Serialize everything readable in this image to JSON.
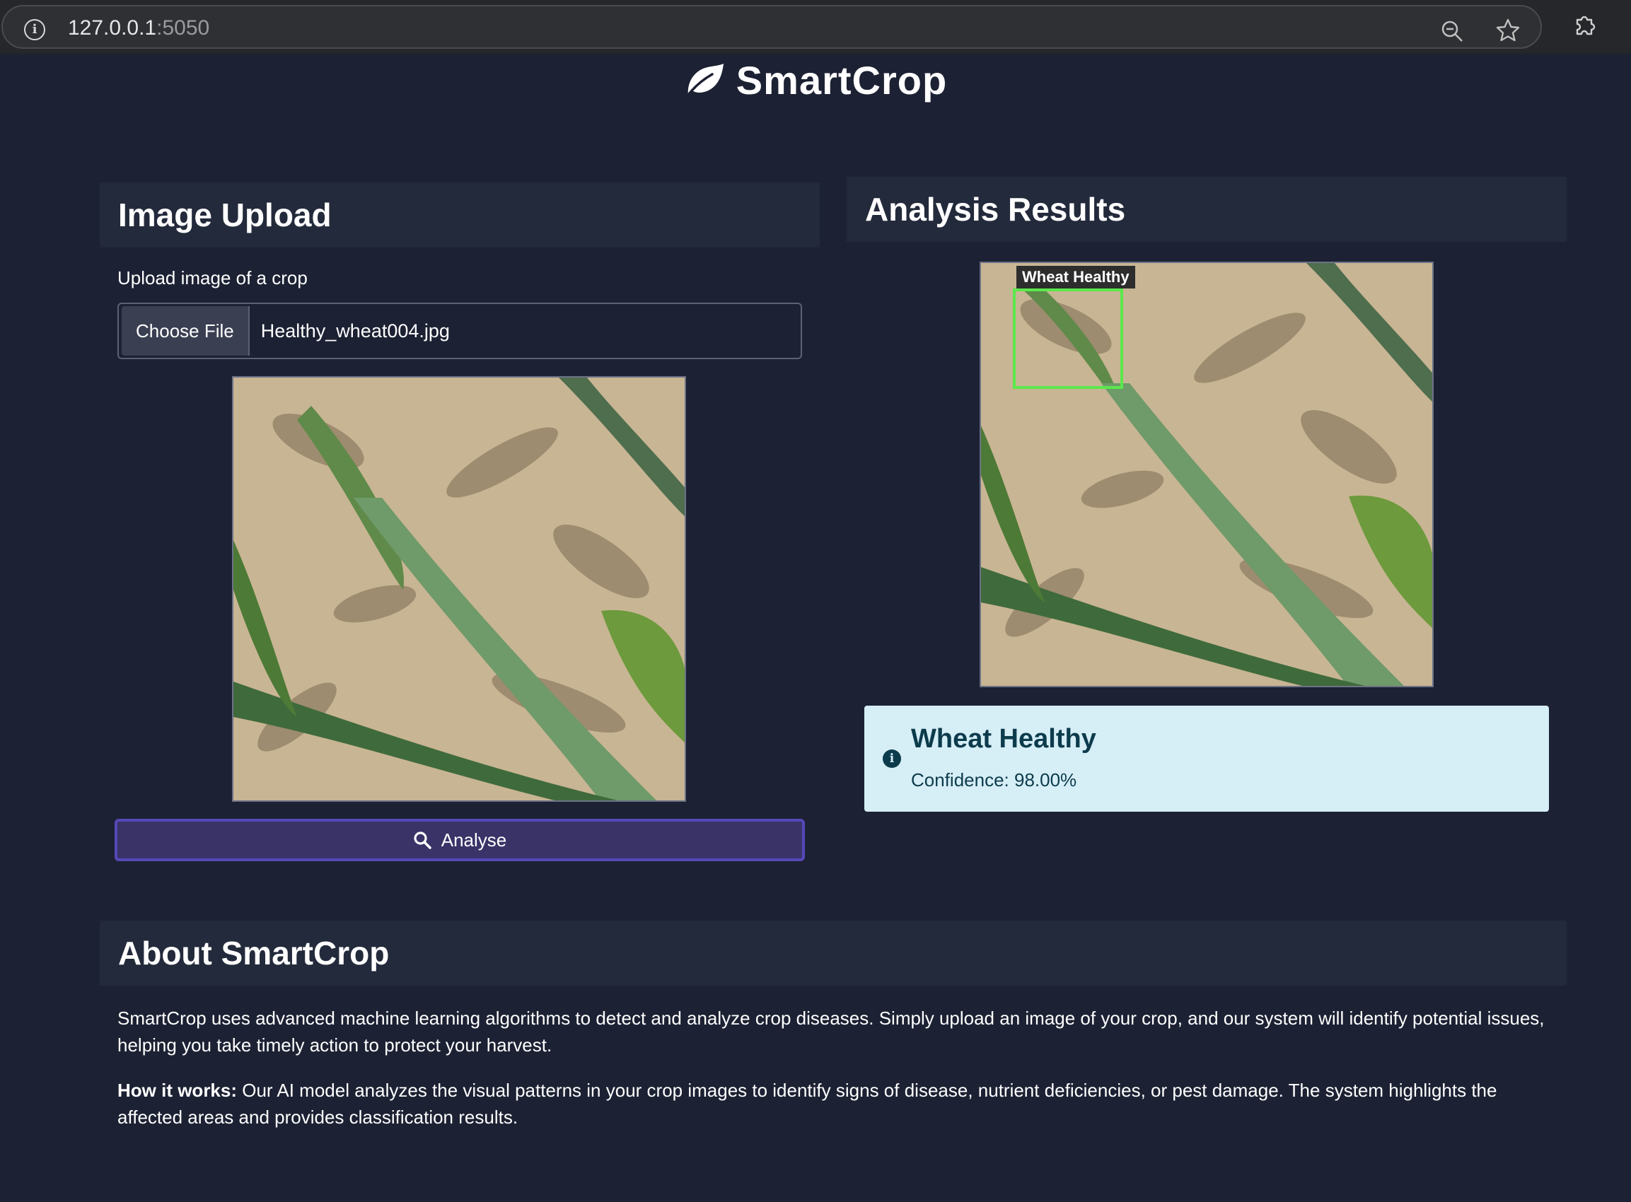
{
  "browser": {
    "url_host": "127.0.0.1",
    "url_port": ":5050",
    "icons": [
      "info-icon",
      "zoom-out-icon",
      "bookmark-star-icon",
      "extensions-icon"
    ]
  },
  "brand": {
    "title": "SmartCrop",
    "icon": "leaf-icon"
  },
  "upload": {
    "heading": "Image Upload",
    "label": "Upload image of a crop",
    "choose_file_label": "Choose File",
    "file_name": "Healthy_wheat004.jpg",
    "analyse_label": "Analyse",
    "analyse_icon": "search-icon"
  },
  "results": {
    "heading": "Analysis Results",
    "detection_label": "Wheat Healthy",
    "prediction": "Wheat Healthy",
    "confidence": "Confidence: 98.00%",
    "info_icon": "info-circle-icon"
  },
  "about": {
    "heading": "About SmartCrop",
    "paragraph1": "SmartCrop uses advanced machine learning algorithms to detect and analyze crop diseases. Simply upload an image of your crop, and our system will identify potential issues, helping you take timely action to protect your harvest.",
    "how_label": "How it works:",
    "how_text": " Our AI model analyzes the visual patterns in your crop images to identify signs of disease, nutrient deficiencies, or pest damage. The system highlights the affected areas and provides classification results."
  },
  "colors": {
    "page_bg": "#1c2133",
    "card_header_bg": "#232a3b",
    "analyse_button": "#3a3368",
    "analyse_border": "#5548b8",
    "result_bg": "#d6eef6",
    "result_text": "#0c3b4c",
    "detection_box": "#5be84c"
  }
}
